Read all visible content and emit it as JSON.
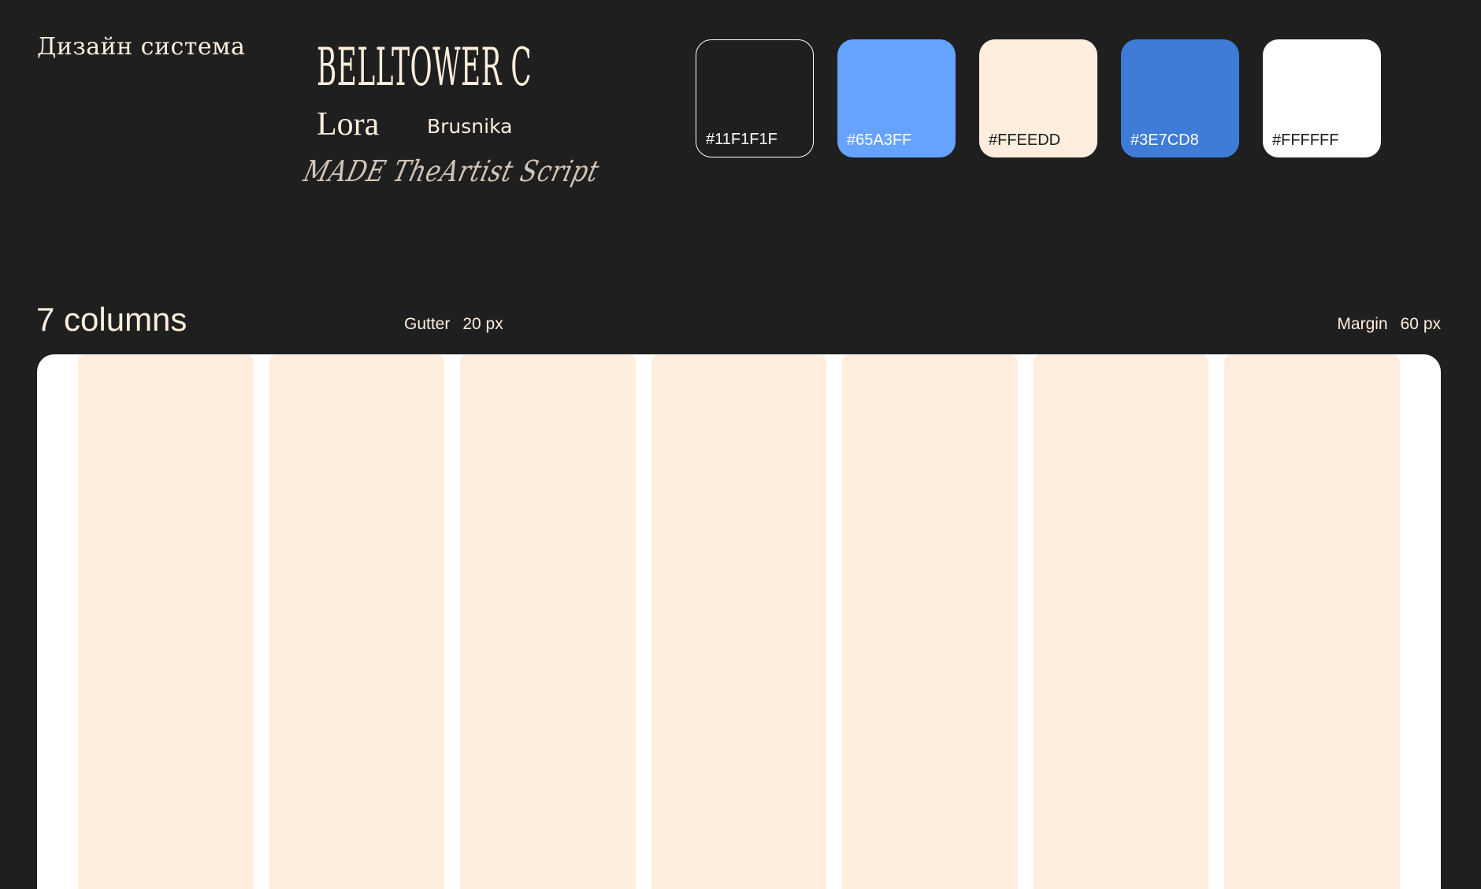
{
  "header": {
    "title": "Дизайн система"
  },
  "typography": {
    "fonts": [
      {
        "name": "BELLTOWER C",
        "role": "display"
      },
      {
        "name": "Lora",
        "role": "serif"
      },
      {
        "name": "Brusnika",
        "role": "sans"
      },
      {
        "name": "MADE TheArtist Script",
        "role": "script"
      }
    ]
  },
  "palette": {
    "swatches": [
      {
        "hex": "#11F1F1F",
        "label": "#11F1F1F",
        "fill": "#1F1F1F",
        "border": "#FFFFFF",
        "text": "#FFFFFF"
      },
      {
        "hex": "#65A3FF",
        "label": "#65A3FF",
        "fill": "#65A3FF",
        "border": "none",
        "text": "#FFFFFF"
      },
      {
        "hex": "#FFEEDD",
        "label": "#FFEEDD",
        "fill": "#FFEEDD",
        "border": "none",
        "text": "#1F1F1F"
      },
      {
        "hex": "#3E7CD8",
        "label": "#3E7CD8",
        "fill": "#3E7CD8",
        "border": "none",
        "text": "#FFFFFF"
      },
      {
        "hex": "#FFFFFF",
        "label": "#FFFFFF",
        "fill": "#FFFFFF",
        "border": "none",
        "text": "#1F1F1F"
      }
    ]
  },
  "grid": {
    "title": "7 columns",
    "column_count": 7,
    "gutter_label": "Gutter",
    "gutter_value": "20 px",
    "margin_label": "Margin",
    "margin_value": "60 px",
    "column_color": "#FFEEDD",
    "background_color": "#FFFFFF"
  },
  "colors": {
    "page_background": "#1F1F1F",
    "text": "#FFEEDD"
  }
}
